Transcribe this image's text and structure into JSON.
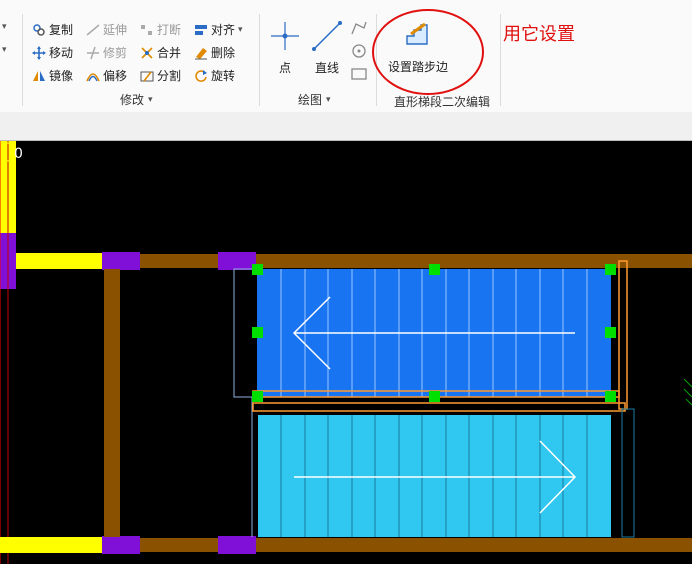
{
  "ribbon": {
    "modify_group": {
      "label": "修改",
      "commands": {
        "copy": "复制",
        "extend": "延伸",
        "break": "打断",
        "align": "对齐",
        "move": "移动",
        "trim": "修剪",
        "merge": "合并",
        "delete": "删除",
        "mirror": "镜像",
        "offset": "偏移",
        "split": "分割",
        "rotate": "旋转"
      }
    },
    "draw_group": {
      "label": "绘图",
      "commands": {
        "point": "点",
        "line": "直线"
      }
    },
    "stair_group": {
      "label": "直形梯段二次编辑",
      "commands": {
        "set_step_edge": "设置踏步边"
      }
    }
  },
  "annotation": {
    "text": "用它设置"
  },
  "canvas": {
    "corner_label": "0"
  },
  "colors": {
    "upper_flight": "#1874f0",
    "lower_flight": "#30c8f0",
    "beam": "#8a5200",
    "column": "#8010d8",
    "wall": "#ffff00",
    "grip": "#00e000",
    "annotation": "#e01010"
  }
}
